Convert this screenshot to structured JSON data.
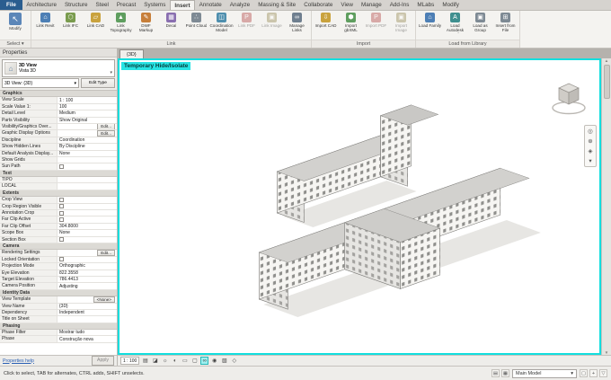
{
  "ribbon": {
    "file_tab": "File",
    "active_tab": "Insert",
    "tabs": [
      "Architecture",
      "Structure",
      "Steel",
      "Precast",
      "Systems",
      "Insert",
      "Annotate",
      "Analyze",
      "Massing & Site",
      "Collaborate",
      "View",
      "Manage",
      "Add-Ins",
      "MLabs",
      "Modify"
    ],
    "select_panel": {
      "modify_label": "Modify",
      "panel_label": "Select ▾",
      "glyph": "↖"
    },
    "groups": [
      {
        "label": "Link",
        "tools": [
          {
            "label": "Link Revit",
            "name": "link-revit",
            "glyph": "⌂",
            "color": "#4d7fb5"
          },
          {
            "label": "Link IFC",
            "name": "link-ifc",
            "glyph": "⬡",
            "color": "#7a9c4e"
          },
          {
            "label": "Link CAD",
            "name": "link-cad",
            "glyph": "▱",
            "color": "#c9a23d"
          },
          {
            "label": "Link Topography",
            "name": "link-topography",
            "glyph": "▲",
            "color": "#5f9e5f"
          },
          {
            "label": "DWF Markup",
            "name": "dwf-markup",
            "glyph": "✎",
            "color": "#c77f3a"
          },
          {
            "label": "Decal",
            "name": "decal",
            "glyph": "▦",
            "color": "#8a6fb0"
          },
          {
            "label": "Point Cloud",
            "name": "point-cloud",
            "glyph": "∴",
            "color": "#7e8a94"
          },
          {
            "label": "Coordination Model",
            "name": "coordination-model",
            "glyph": "◫",
            "color": "#4f8fae"
          },
          {
            "label": "Link PDF",
            "name": "link-pdf",
            "glyph": "P",
            "color": "#b8504f",
            "disabled": true
          },
          {
            "label": "Link Image",
            "name": "link-image",
            "glyph": "▣",
            "color": "#9b8f5a",
            "disabled": true
          },
          {
            "label": "Manage Links",
            "name": "manage-links",
            "glyph": "∞",
            "color": "#6f7f8f"
          }
        ]
      },
      {
        "label": "Import",
        "tools": [
          {
            "label": "Import CAD",
            "name": "import-cad",
            "glyph": "⇩",
            "color": "#c9a23d"
          },
          {
            "label": "Import gbXML",
            "name": "import-gbxml",
            "glyph": "⬢",
            "color": "#5f9e5f"
          },
          {
            "label": "Import PDF",
            "name": "import-pdf",
            "glyph": "P",
            "color": "#b8504f",
            "disabled": true
          },
          {
            "label": "Import Image",
            "name": "import-image",
            "glyph": "▣",
            "color": "#9b8f5a",
            "disabled": true
          }
        ]
      },
      {
        "label": "Load from Library",
        "tools": [
          {
            "label": "Load Family",
            "name": "load-family",
            "glyph": "⌂",
            "color": "#4d7fb5"
          },
          {
            "label": "Load Autodesk Family",
            "name": "load-autodesk-family",
            "glyph": "A",
            "color": "#3f8f8f"
          },
          {
            "label": "Load as Group",
            "name": "load-as-group",
            "glyph": "▣",
            "color": "#7e8a94"
          },
          {
            "label": "Insert from File",
            "name": "insert-from-file",
            "glyph": "⊞",
            "color": "#7e8a94"
          }
        ]
      }
    ]
  },
  "properties": {
    "title": "Properties",
    "type_selector": {
      "family": "3D View",
      "type": "Vista 3D"
    },
    "instance_label": "3D View: {3D}",
    "edit_type": "Edit Type",
    "rows": [
      {
        "kind": "section",
        "label": "Graphics"
      },
      {
        "label": "View Scale",
        "value": "1 : 100"
      },
      {
        "label": "Scale Value    1:",
        "value": "100"
      },
      {
        "label": "Detail Level",
        "value": "Medium"
      },
      {
        "label": "Parts Visibility",
        "value": "Show Original"
      },
      {
        "label": "Visibility/Graphics Over...",
        "value": "Edit...",
        "kind": "button"
      },
      {
        "label": "Graphic Display Options",
        "value": "Edit...",
        "kind": "button"
      },
      {
        "label": "Discipline",
        "value": "Coordination"
      },
      {
        "label": "Show Hidden Lines",
        "value": "By Discipline"
      },
      {
        "label": "Default Analysis Display...",
        "value": "None"
      },
      {
        "label": "Show Grids",
        "value": ""
      },
      {
        "label": "Sun Path",
        "kind": "checkbox",
        "checked": false
      },
      {
        "kind": "section",
        "label": "Text"
      },
      {
        "label": "TIPO",
        "value": ""
      },
      {
        "label": "LOCAL",
        "value": ""
      },
      {
        "kind": "section",
        "label": "Extents"
      },
      {
        "label": "Crop View",
        "kind": "checkbox",
        "checked": false
      },
      {
        "label": "Crop Region Visible",
        "kind": "checkbox",
        "checked": false
      },
      {
        "label": "Annotation Crop",
        "kind": "checkbox",
        "checked": false
      },
      {
        "label": "Far Clip Active",
        "kind": "checkbox",
        "checked": false
      },
      {
        "label": "Far Clip Offset",
        "value": "304.8000"
      },
      {
        "label": "Scope Box",
        "value": "None"
      },
      {
        "label": "Section Box",
        "kind": "checkbox",
        "checked": false
      },
      {
        "kind": "section",
        "label": "Camera"
      },
      {
        "label": "Rendering Settings",
        "value": "Edit...",
        "kind": "button"
      },
      {
        "label": "Locked Orientation",
        "kind": "checkbox",
        "checked": false
      },
      {
        "label": "Projection Mode",
        "value": "Orthographic"
      },
      {
        "label": "Eye Elevation",
        "value": "822.3558"
      },
      {
        "label": "Target Elevation",
        "value": "786.4413"
      },
      {
        "label": "Camera Position",
        "value": "Adjusting"
      },
      {
        "kind": "section",
        "label": "Identity Data"
      },
      {
        "label": "View Template",
        "value": "<None>",
        "kind": "button"
      },
      {
        "label": "View Name",
        "value": "{3D}"
      },
      {
        "label": "Dependency",
        "value": "Independent"
      },
      {
        "label": "Title on Sheet",
        "value": ""
      },
      {
        "kind": "section",
        "label": "Phasing"
      },
      {
        "label": "Phase Filter",
        "value": "Mostrar tudo"
      },
      {
        "label": "Phase",
        "value": "Construção nova"
      }
    ],
    "help_link": "Properties help",
    "apply_button": "Apply"
  },
  "viewport": {
    "view_tab": "{3D}",
    "banner": "Temporary Hide/Isolate",
    "accent_color": "#12dede"
  },
  "navigation_bar": {
    "icons": [
      {
        "name": "navigation-wheel-icon",
        "glyph": "◎"
      },
      {
        "name": "zoom-icon",
        "glyph": "⊕"
      },
      {
        "name": "pan-icon",
        "glyph": "◈"
      },
      {
        "name": "navbar-options-chevron-icon",
        "glyph": "▾"
      }
    ]
  },
  "view_control_bar": {
    "scale": "1 : 100",
    "icons": [
      {
        "name": "detail-level-icon",
        "glyph": "▤"
      },
      {
        "name": "visual-style-icon",
        "glyph": "◪"
      },
      {
        "name": "sun-path-icon",
        "glyph": "☼"
      },
      {
        "name": "shadows-icon",
        "glyph": "◐"
      },
      {
        "name": "crop-view-icon",
        "glyph": "▭"
      },
      {
        "name": "crop-region-visibility-icon",
        "glyph": "▢"
      },
      {
        "name": "temporary-hide-isolate-icon",
        "glyph": "∞",
        "active": true
      },
      {
        "name": "reveal-hidden-elements-icon",
        "glyph": "◉"
      },
      {
        "name": "temporary-view-properties-icon",
        "glyph": "▧"
      },
      {
        "name": "constraints-icon",
        "glyph": "◇"
      }
    ]
  },
  "status_bar": {
    "hint": "Click to select, TAB for alternates, CTRL adds, SHIFT unselects.",
    "main_model": "Main Model",
    "left_icons": [
      {
        "name": "worksets-icon",
        "glyph": "▤"
      },
      {
        "name": "design-options-icon",
        "glyph": "▦"
      }
    ],
    "right_icons": [
      {
        "name": "editable-only-icon",
        "glyph": "▢"
      },
      {
        "name": "press-drag-icon",
        "glyph": "+"
      },
      {
        "name": "selection-filter-icon",
        "glyph": "▽"
      }
    ]
  },
  "glyphs": {
    "dropdown": "▾",
    "scroll_up": "▲",
    "scroll_down": "▼"
  }
}
